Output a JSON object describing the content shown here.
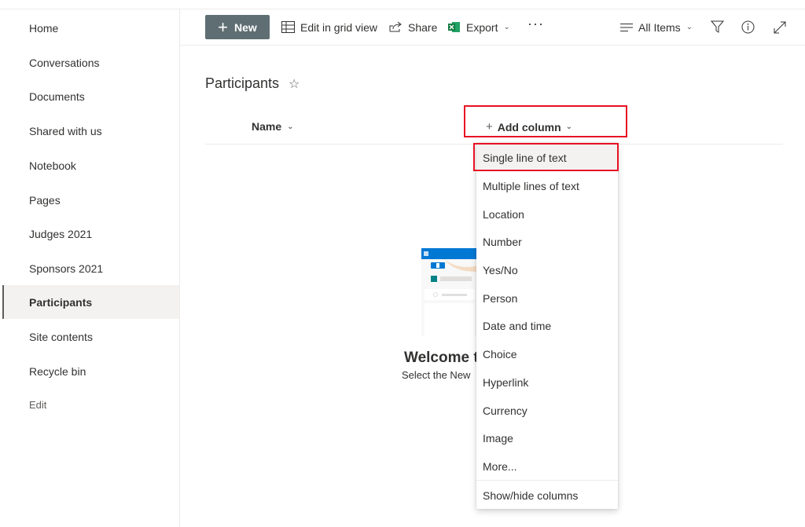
{
  "sidebar": {
    "items": [
      {
        "label": "Home"
      },
      {
        "label": "Conversations"
      },
      {
        "label": "Documents"
      },
      {
        "label": "Shared with us"
      },
      {
        "label": "Notebook"
      },
      {
        "label": "Pages"
      },
      {
        "label": "Judges 2021"
      },
      {
        "label": "Sponsors 2021"
      },
      {
        "label": "Participants",
        "selected": true
      },
      {
        "label": "Site contents"
      },
      {
        "label": "Recycle bin"
      }
    ],
    "edit_label": "Edit"
  },
  "toolbar": {
    "new_label": "New",
    "edit_grid_label": "Edit in grid view",
    "share_label": "Share",
    "export_label": "Export",
    "more_label": "···",
    "view_label": "All Items",
    "icons": [
      "plus-icon",
      "grid-icon",
      "share-icon",
      "excel-icon",
      "chevron-down-icon",
      "more-icon",
      "list-view-icon",
      "filter-icon",
      "info-icon",
      "expand-icon"
    ]
  },
  "list": {
    "title": "Participants",
    "columns": {
      "name_label": "Name",
      "add_column_label": "Add column"
    },
    "empty_state": {
      "title": "Welcome t",
      "subtitle": "Select the New"
    }
  },
  "add_column_menu": {
    "items": [
      {
        "label": "Single line of text",
        "highlighted": true
      },
      {
        "label": "Multiple lines of text"
      },
      {
        "label": "Location"
      },
      {
        "label": "Number"
      },
      {
        "label": "Yes/No"
      },
      {
        "label": "Person"
      },
      {
        "label": "Date and time"
      },
      {
        "label": "Choice"
      },
      {
        "label": "Hyperlink"
      },
      {
        "label": "Currency"
      },
      {
        "label": "Image"
      },
      {
        "label": "More..."
      }
    ],
    "footer_label": "Show/hide columns"
  },
  "colors": {
    "new_button_bg": "#5f6e72",
    "highlight_border": "#e81123",
    "selected_nav_bg": "#f3f2f1",
    "excel_green": "#107c41",
    "illustration_blue": "#0078d4",
    "illustration_teal": "#038387"
  }
}
